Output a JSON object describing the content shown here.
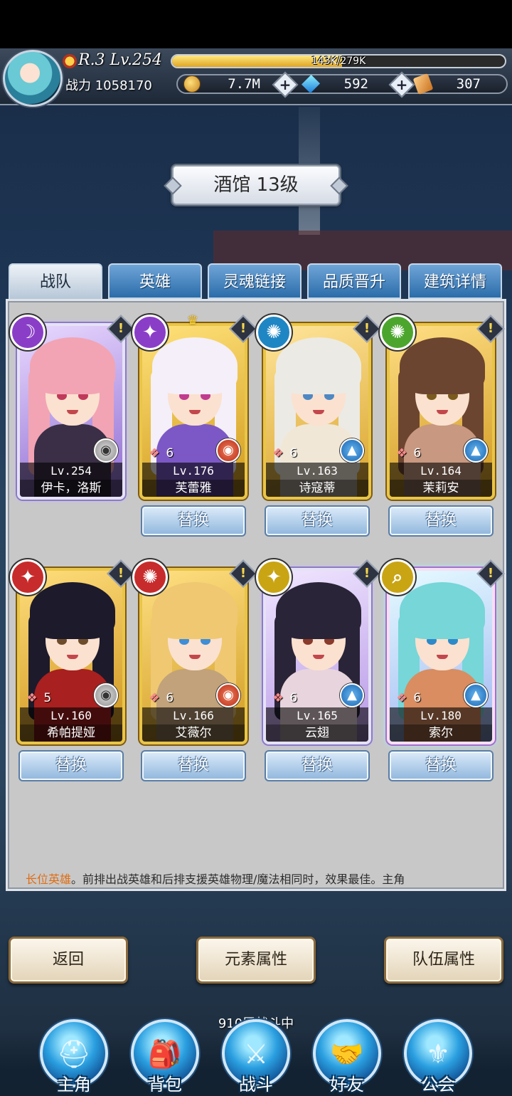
{
  "hud": {
    "rank_level": "R.3 Lv.254",
    "exp_text": "143K/279K",
    "exp_progress": 0.51,
    "power_label": "战力 1058170",
    "gold": "7.7M",
    "gems": "592",
    "tickets": "307"
  },
  "title": "酒馆 13级",
  "tabs": [
    {
      "label": "战队",
      "active": true
    },
    {
      "label": "英雄",
      "active": false
    },
    {
      "label": "灵魂链接",
      "active": false
    },
    {
      "label": "品质晋升",
      "active": false
    },
    {
      "label": "建筑详情",
      "active": false
    }
  ],
  "heroes": [
    {
      "name": "伊卡，洛斯",
      "level": "Lv.254",
      "rank": "",
      "element": "moon",
      "element_color": "#8a3ec8",
      "class": "grey",
      "swap": ""
    },
    {
      "name": "芙蕾雅",
      "level": "Lv.176",
      "rank": "6",
      "element": "light",
      "element_color": "#8a3ec8",
      "class": "war",
      "swap": "替换",
      "crown": "G"
    },
    {
      "name": "诗寇蒂",
      "level": "Lv.163",
      "rank": "6",
      "element": "wind",
      "element_color": "#1f86c4",
      "class": "mage",
      "swap": "替换"
    },
    {
      "name": "茉莉安",
      "level": "Lv.164",
      "rank": "6",
      "element": "wind",
      "element_color": "#4ca62e",
      "class": "mage",
      "swap": "替换"
    },
    {
      "name": "希帕提娅",
      "level": "Lv.160",
      "rank": "5",
      "element": "light",
      "element_color": "#c82b2b",
      "class": "grey",
      "swap": "替换"
    },
    {
      "name": "艾薇尔",
      "level": "Lv.166",
      "rank": "6",
      "element": "wind",
      "element_color": "#c82b2b",
      "class": "war",
      "swap": "替换"
    },
    {
      "name": "云翅",
      "level": "Lv.165",
      "rank": "6",
      "element": "light",
      "element_color": "#c9a514",
      "class": "mage",
      "swap": "替换"
    },
    {
      "name": "索尔",
      "level": "Lv.180",
      "rank": "6",
      "element": "search",
      "element_color": "#c9a514",
      "class": "mage",
      "swap": "替换"
    }
  ],
  "tip": {
    "highlight": "长位英雄",
    "text": "。前排出战英雄和后排支援英雄物理/魔法相同时，效果最佳。主角"
  },
  "buttons": {
    "back": "返回",
    "element_attr": "元素属性",
    "team_attr": "队伍属性"
  },
  "battle_status": "910层战斗中",
  "nav": [
    {
      "label": "主角",
      "icon": "knight-helmet-icon"
    },
    {
      "label": "背包",
      "icon": "backpack-icon"
    },
    {
      "label": "战斗",
      "icon": "crossed-swords-icon"
    },
    {
      "label": "好友",
      "icon": "handshake-icon"
    },
    {
      "label": "公会",
      "icon": "guild-crest-icon"
    }
  ]
}
